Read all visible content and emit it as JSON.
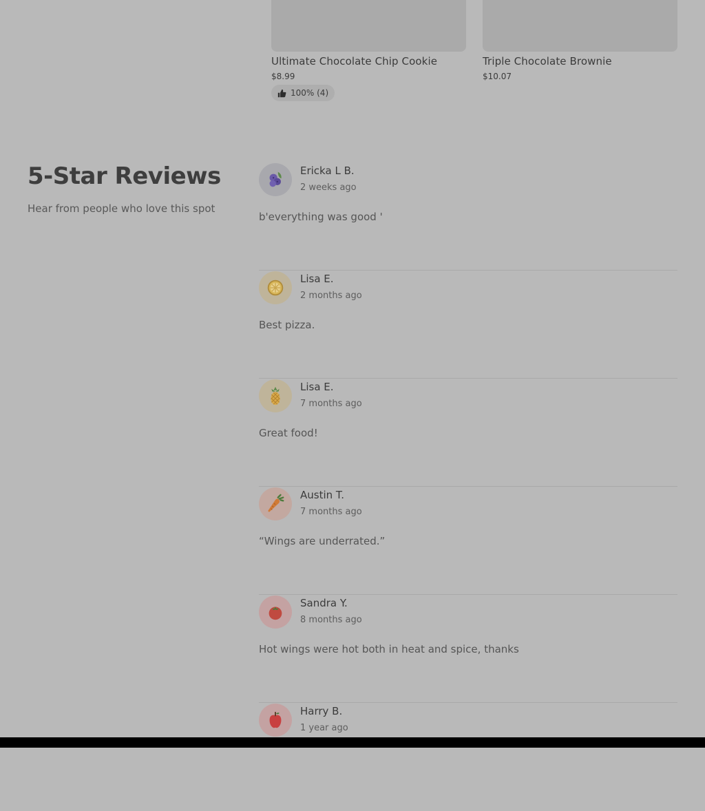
{
  "products": [
    {
      "name": "Ultimate Chocolate Chip Cookie",
      "price": "$8.99",
      "rating": "100% (4)"
    },
    {
      "name": "Triple Chocolate Brownie",
      "price": "$10.07"
    }
  ],
  "reviews_section": {
    "title": "5-Star Reviews",
    "subtitle": "Hear from people who love this spot",
    "reviews": [
      {
        "name": "Ericka L B.",
        "time": "2 weeks ago",
        "text": "b'everything was good '",
        "avatar_icon": "blueberry-icon",
        "avatar_bg": "#a8a8ad"
      },
      {
        "name": "Lisa E.",
        "time": "2 months ago",
        "text": "Best pizza.",
        "avatar_icon": "lemon-icon",
        "avatar_bg": "#bfb49a"
      },
      {
        "name": "Lisa E.",
        "time": "7 months ago",
        "text": "Great food!",
        "avatar_icon": "pineapple-icon",
        "avatar_bg": "#bfb49a"
      },
      {
        "name": "Austin T.",
        "time": "7 months ago",
        "text": "“Wings are underrated.”",
        "avatar_icon": "carrot-icon",
        "avatar_bg": "#c3a8a0"
      },
      {
        "name": "Sandra Y.",
        "time": "8 months ago",
        "text": "Hot wings were hot both in heat and spice, thanks",
        "avatar_icon": "tomato-icon",
        "avatar_bg": "#c4a2a2"
      },
      {
        "name": "Harry B.",
        "time": "1 year ago",
        "text": "",
        "avatar_icon": "apple-icon",
        "avatar_bg": "#c4a2a2"
      }
    ]
  }
}
